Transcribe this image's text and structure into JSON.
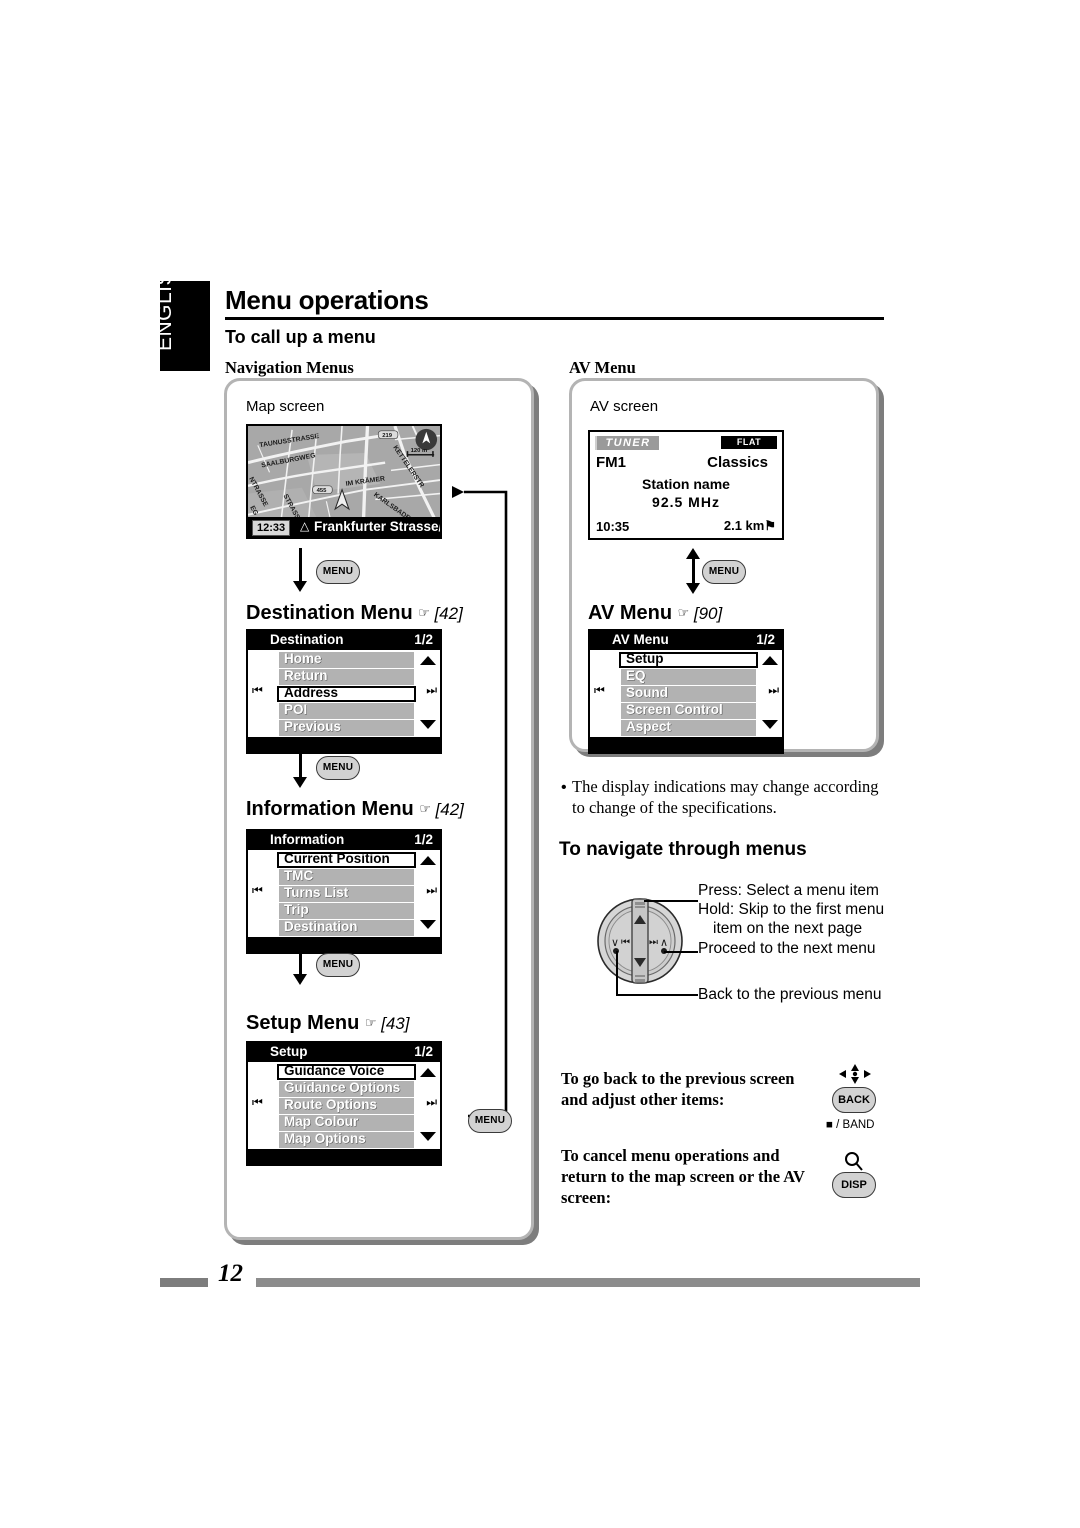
{
  "language_tab": "ENGLISH",
  "header": {
    "title": "Menu operations",
    "subtitle": "To call up a menu"
  },
  "columns": {
    "left_label": "Navigation Menus",
    "right_label": "AV Menu"
  },
  "navigation_panel": {
    "caption": "Map screen",
    "map_screen": {
      "clock": "12:33",
      "direction_icon": "triangle-heading-icon",
      "street": "Frankfurter Strasse/..",
      "scale": "120 m",
      "street_labels": [
        "TAUNUSSTRASSE",
        "SAALBURGWEG",
        "NTRASSE",
        "STRASSE",
        "EG",
        "IM KRÄMER",
        "KETTELERSTR",
        "KARLSBADER STRASSE"
      ],
      "road_shields": [
        "219",
        "455"
      ]
    },
    "stages": [
      {
        "label": "Destination Menu",
        "ref": "[42]",
        "menu": {
          "title": "Destination",
          "page": "1/2",
          "items": [
            "Home",
            "Return",
            "Address",
            "POI",
            "Previous"
          ],
          "selected_index": 2,
          "prev_icon": "skip-previous-icon",
          "next_icon": "skip-next-icon",
          "scroll_up_icon": "triangle-up-icon",
          "scroll_down_icon": "triangle-down-icon"
        }
      },
      {
        "label": "Information Menu",
        "ref": "[42]",
        "menu": {
          "title": "Information",
          "page": "1/2",
          "items": [
            "Current Position",
            "TMC",
            "Turns List",
            "Trip",
            "Destination"
          ],
          "selected_index": 0,
          "prev_icon": "skip-previous-icon",
          "next_icon": "skip-next-icon",
          "scroll_up_icon": "triangle-up-icon",
          "scroll_down_icon": "triangle-down-icon"
        }
      },
      {
        "label": "Setup Menu",
        "ref": "[43]",
        "menu": {
          "title": "Setup",
          "page": "1/2",
          "items": [
            "Guidance Voice",
            "Guidance Options",
            "Route Options",
            "Map Colour",
            "Map Options"
          ],
          "selected_index": 0,
          "prev_icon": "skip-previous-icon",
          "next_icon": "skip-next-icon",
          "scroll_up_icon": "triangle-up-icon",
          "scroll_down_icon": "triangle-down-icon"
        }
      }
    ],
    "menu_button_label": "MENU"
  },
  "av_panel": {
    "caption": "AV screen",
    "av_screen": {
      "source_badge": "TUNER",
      "eq_badge": "FLAT",
      "band": "FM1",
      "genre": "Classics",
      "station_name": "Station name",
      "frequency": "92.5   MHz",
      "clock": "10:35",
      "distance": "2.1 km",
      "distance_icon": "flag-icon"
    },
    "stage": {
      "label": "AV Menu",
      "ref": "[90]",
      "menu": {
        "title": "AV Menu",
        "page": "1/2",
        "items": [
          "Setup",
          "EQ",
          "Sound",
          "Screen Control",
          "Aspect"
        ],
        "selected_index": 0,
        "prev_icon": "skip-previous-icon",
        "next_icon": "skip-next-icon",
        "scroll_up_icon": "triangle-up-icon",
        "scroll_down_icon": "triangle-down-icon"
      }
    },
    "menu_button_label": "MENU"
  },
  "note": {
    "bullet": "•",
    "text": "The display indications may change according to change of the specifications."
  },
  "navigate_section": {
    "heading": "To navigate through menus",
    "callouts": {
      "press": "Press: Select a menu item",
      "hold_line1": "Hold: Skip to the first menu",
      "hold_line2": "item on the next page",
      "proceed": "Proceed to the next menu",
      "back": "Back to the previous menu"
    },
    "joystick_icon": "rotary-joystick-icon"
  },
  "remote_actions": [
    {
      "text_line1": "To go back to the previous screen",
      "text_line2": "and adjust other items:",
      "button_label": "BACK",
      "top_icon": "dpad-icon",
      "bottom_caption": "■ / BAND"
    },
    {
      "text_line1": "To cancel menu operations and",
      "text_line2": "return to the map screen or the AV",
      "text_line3": "screen:",
      "button_label": "DISP",
      "top_icon": "magnifier-icon",
      "bottom_caption": ""
    }
  ],
  "footer": {
    "page_number": "12"
  },
  "colors": {
    "panel_border": "#b4b4b4",
    "panel_shadow": "#7d7d7d",
    "lcd_row": "#b2b2b2",
    "lcd_bar": "#000000",
    "footer_rule": "#8c8c8c",
    "button_face": "#d2d2d2"
  }
}
